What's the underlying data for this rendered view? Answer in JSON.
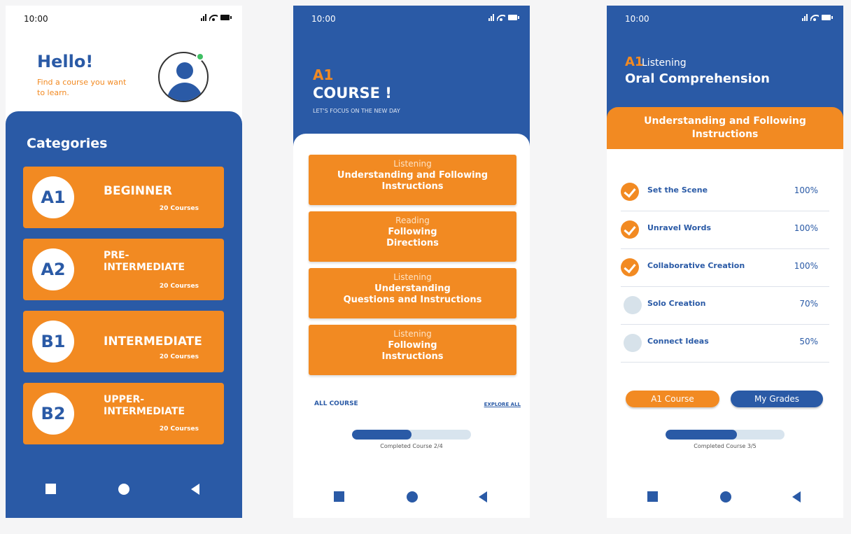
{
  "colors": {
    "brand_blue": "#2a5aa6",
    "accent_orange": "#f28a22",
    "track": "#d8e4ee",
    "online": "#3fbf63"
  },
  "status_bar": {
    "time": "10:00",
    "icons": [
      "signal-icon",
      "wifi-icon",
      "battery-icon"
    ]
  },
  "screen_categories": {
    "greeting": "Hello!",
    "subtitle": "Find a course you want to learn.",
    "categories_title": "Categories",
    "categories": [
      {
        "badge": "A1",
        "name": "BEGINNER",
        "count": "20 Courses"
      },
      {
        "badge": "A2",
        "name": "PRE-\nINTERMEDIATE",
        "count": "20 Courses"
      },
      {
        "badge": "B1",
        "name": "INTERMEDIATE",
        "count": "20 Courses"
      },
      {
        "badge": "B2",
        "name": "UPPER-\nINTERMEDIATE",
        "count": "20 Courses"
      }
    ]
  },
  "screen_course": {
    "level": "A1",
    "title": "COURSE !",
    "subtitle": "LET'S FOCUS ON THE NEW DAY",
    "lessons": [
      {
        "kind": "Listening",
        "title": "Understanding and Following\nInstructions"
      },
      {
        "kind": "Reading",
        "title": "Following\nDirections"
      },
      {
        "kind": "Listening",
        "title": "Understanding\nQuestions and Instructions"
      },
      {
        "kind": "Listening",
        "title": "Following\nInstructions"
      }
    ],
    "all_course_link": "ALL COURSE",
    "explore_all_link": "EXPLORE ALL",
    "progress": {
      "completed": 2,
      "total": 4,
      "label": "Completed Course 2/4"
    }
  },
  "screen_lesson": {
    "level": "A1",
    "kind": "Listening",
    "title": "Oral Comprehension",
    "banner": "Understanding and Following\nInstructions",
    "tasks": [
      {
        "name": "Set the Scene",
        "percent": "100%",
        "done": true
      },
      {
        "name": "Unravel Words",
        "percent": "100%",
        "done": true
      },
      {
        "name": "Collaborative Creation",
        "percent": "100%",
        "done": true
      },
      {
        "name": "Solo Creation",
        "percent": "70%",
        "done": false
      },
      {
        "name": "Connect Ideas",
        "percent": "50%",
        "done": false
      }
    ],
    "course_button": "A1 Course",
    "grades_button": "My Grades",
    "progress": {
      "completed": 3,
      "total": 5,
      "label": "Completed Course 3/5"
    }
  },
  "nav_bar": {
    "icons": [
      "square-icon",
      "circle-home-icon",
      "back-triangle-icon"
    ]
  }
}
